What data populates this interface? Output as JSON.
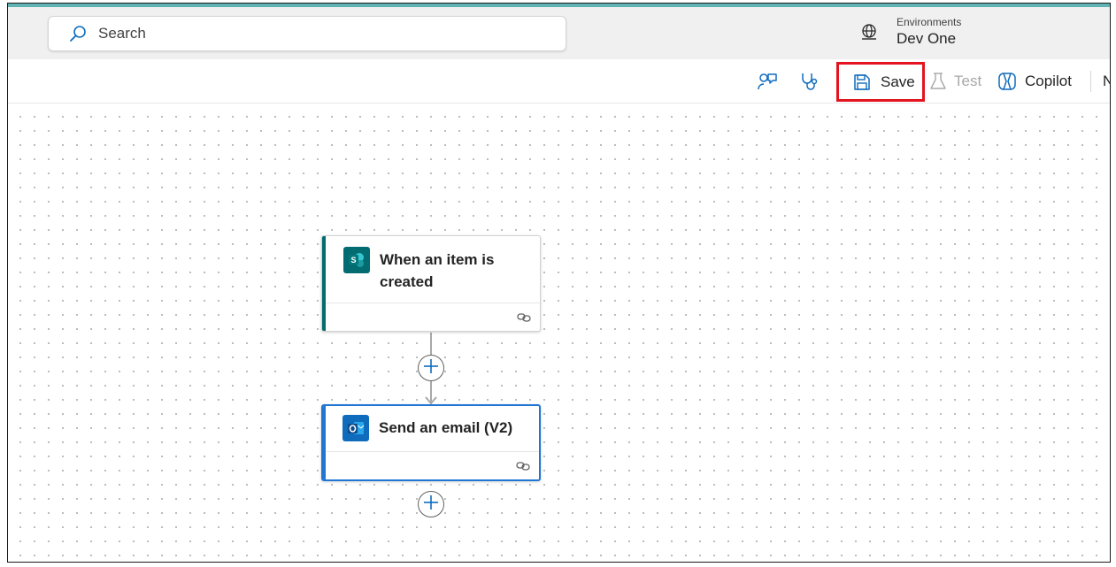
{
  "header": {
    "search_placeholder": "Search",
    "environments_label": "Environments",
    "environment_name": "Dev One"
  },
  "command_bar": {
    "save_label": "Save",
    "test_label": "Test",
    "copilot_label": "Copilot",
    "overflow_label": "N"
  },
  "flow": {
    "trigger": {
      "title": "When an item is created",
      "app": "SharePoint",
      "app_color": "#036c70"
    },
    "action": {
      "title": "Send an email (V2)",
      "app": "Outlook",
      "app_color": "#0f6cbd"
    }
  },
  "highlight": {
    "target": "save-button",
    "color": "#e3141f"
  },
  "icons": [
    "search-icon",
    "globe-icon",
    "feedback-icon",
    "flow-checker-icon",
    "save-icon",
    "test-flask-icon",
    "copilot-icon",
    "sharepoint-icon",
    "outlook-icon",
    "link-icon",
    "plus-icon"
  ]
}
